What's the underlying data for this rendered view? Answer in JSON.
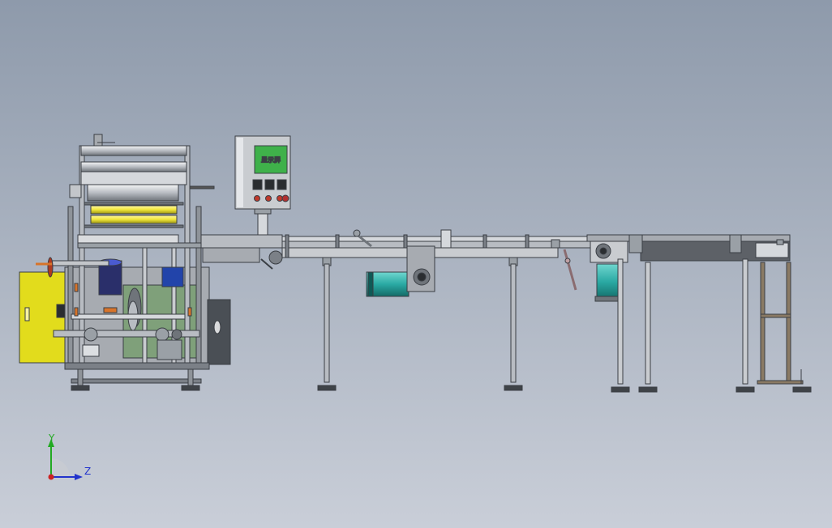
{
  "viewport": {
    "background_top": "#8e9aab",
    "background_bottom": "#c9ced8"
  },
  "control_panel": {
    "screen_label": "显示屏",
    "screen_color": "#3fb14a",
    "button_colors": [
      "#c0392b",
      "#c0392b",
      "#c0392b"
    ],
    "dial_color": "#b03030"
  },
  "triad": {
    "y_label": "Y",
    "z_label": "Z",
    "y_color": "#22aa22",
    "z_color": "#2233cc",
    "origin_color": "#cc2222"
  },
  "colors": {
    "frame": "#9ea3aa",
    "frame_dark": "#555a60",
    "guard_yellow": "#e2dc1c",
    "roller_yellow": "#f0e63a",
    "motor_teal": "#2aa9a3",
    "motor_blue": "#2244aa",
    "panel_green": "#7fa07a",
    "accent_orange": "#d8742a",
    "leg_brown": "#8a7a64"
  }
}
